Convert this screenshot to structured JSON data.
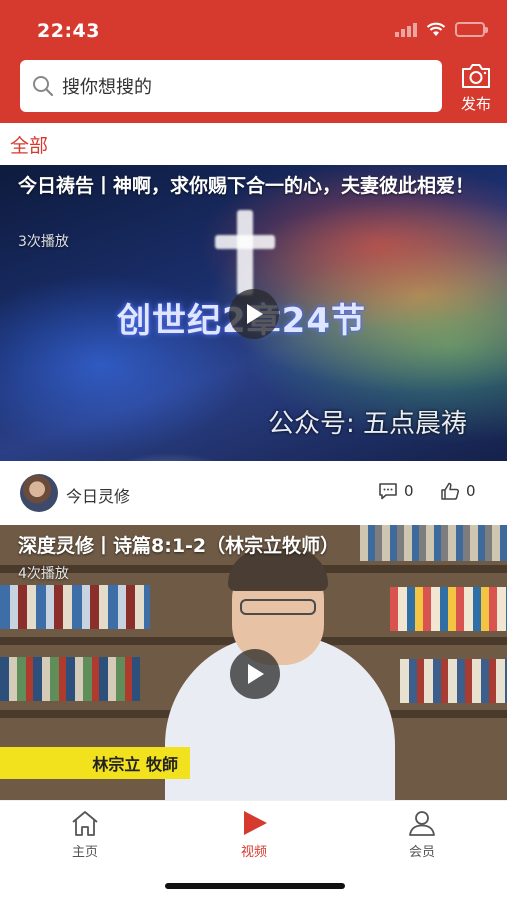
{
  "status_bar": {
    "time": "22:43"
  },
  "search": {
    "placeholder": "搜你想搜的"
  },
  "header": {
    "publish_label": "发布"
  },
  "category": {
    "label": "全部"
  },
  "videos": [
    {
      "title": "今日祷告丨神啊，求你赐下合一的心，夫妻彼此相爱！",
      "plays": "3次播放",
      "overlay_text": "创世纪2章24节",
      "watermark": "公众号: 五点晨祷"
    },
    {
      "title": "深度灵修丨诗篇8:1-2（林宗立牧师）",
      "plays": "4次播放",
      "name_banner": "林宗立  牧師"
    }
  ],
  "author": {
    "name": "今日灵修",
    "comments": "0",
    "likes": "0"
  },
  "tabbar": {
    "items": [
      {
        "label": "主页"
      },
      {
        "label": "视频"
      },
      {
        "label": "会员"
      }
    ]
  },
  "colors": {
    "brand": "#d63a2f",
    "active_tab": "#d63a2f"
  }
}
